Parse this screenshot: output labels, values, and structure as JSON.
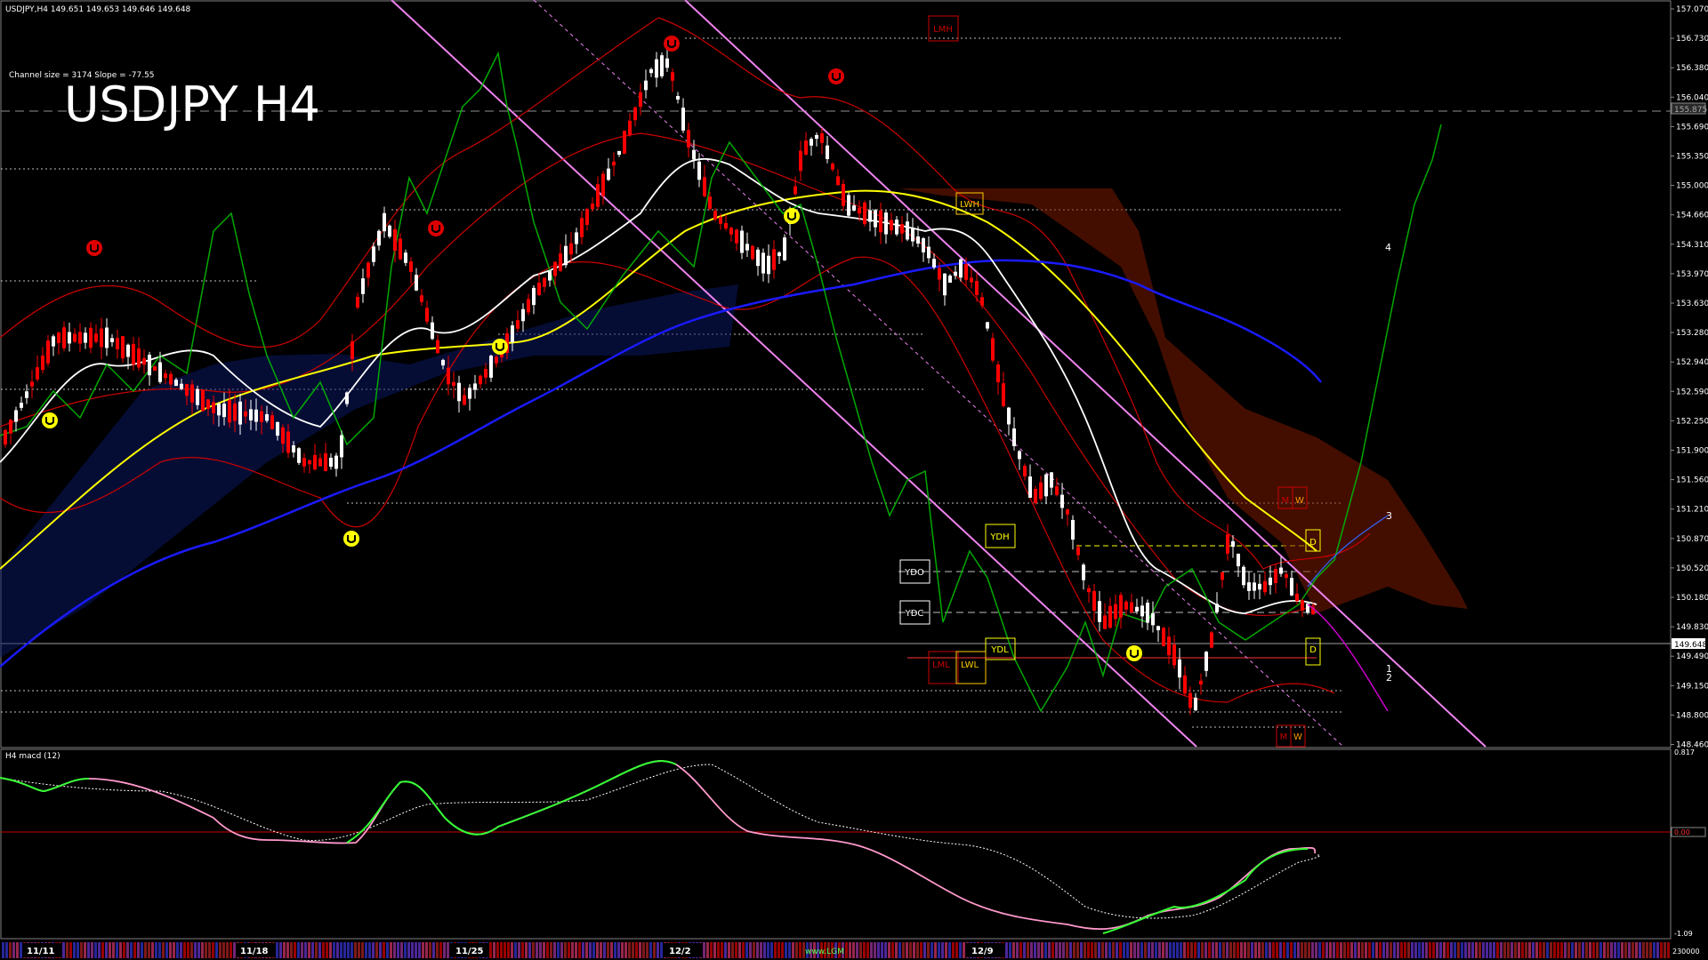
{
  "header": {
    "symbol_line": "USDJPY,H4  149.651 149.653 149.646 149.648",
    "channel_info": "Channel size = 3174 Slope = -77.55",
    "big_title": "USDJPY H4"
  },
  "price_axis": {
    "labels": [
      "157.070",
      "156.730",
      "156.380",
      "156.040",
      "155.690",
      "155.350",
      "155.000",
      "154.660",
      "154.310",
      "153.970",
      "153.630",
      "153.280",
      "152.940",
      "152.590",
      "152.250",
      "151.900",
      "151.560",
      "151.210",
      "150.870",
      "150.520",
      "150.180",
      "149.830",
      "149.490",
      "149.150",
      "148.800",
      "148.460"
    ],
    "current_price": "149.648",
    "ref_price_box": "155.875"
  },
  "level_boxes": {
    "lmh": "LMH",
    "lwh": "LWH",
    "ydh": "YDH",
    "ydo": "YDO",
    "ydc": "YDC",
    "ydl": "YDL",
    "lml": "LML",
    "lwl": "LWL",
    "m_top": "M",
    "w_top": "W",
    "d_top": "D",
    "d_bottom": "D",
    "m_bottom": "M",
    "w_bottom": "W"
  },
  "wave_labels": [
    "4",
    "3",
    "1",
    "2"
  ],
  "macd_panel": {
    "label": "H4  macd (12)",
    "axis_labels": [
      "0.817",
      "0.00",
      "-1.09"
    ],
    "volume_label": "230000"
  },
  "time_axis": {
    "dates": [
      "11/11",
      "11/18",
      "11/25",
      "12/2",
      "12/9"
    ],
    "overlay_text": "www.LGM"
  },
  "colors": {
    "background": "#000000",
    "bull_candle": "#ffffff",
    "bear_candle": "#ff0000",
    "ma_yellow": "#ffff00",
    "ma_blue": "#1a1aff",
    "ma_white": "#ffffff",
    "bands_red": "#cc0000",
    "channel_violet": "#ee82ee",
    "green_osc": "#00cc00",
    "macd_green": "#33ff33",
    "macd_pink": "#ff99cc",
    "cloud_orange": "#cc5500"
  }
}
